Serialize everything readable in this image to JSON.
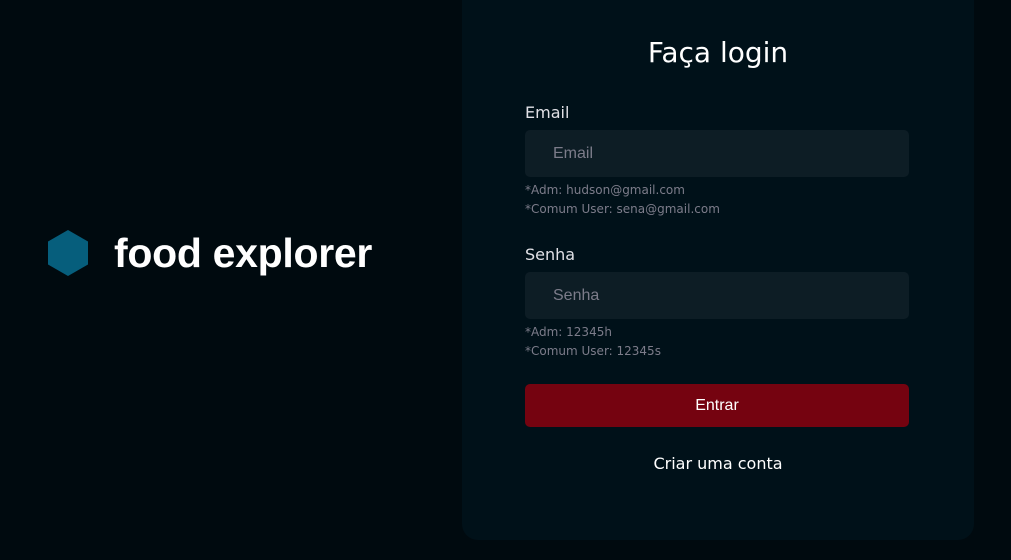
{
  "brand": {
    "name": "food explorer",
    "icon": "hexagon-logo-icon",
    "logo_color": "#065e7c"
  },
  "login": {
    "title": "Faça login",
    "email": {
      "label": "Email",
      "placeholder": "Email",
      "value": "",
      "hints": [
        "*Adm: hudson@gmail.com",
        "*Comum User: sena@gmail.com"
      ]
    },
    "password": {
      "label": "Senha",
      "placeholder": "Senha",
      "value": "",
      "hints": [
        "*Adm: 12345h",
        "*Comum User: 12345s"
      ]
    },
    "submit_label": "Entrar",
    "create_account_label": "Criar uma conta"
  },
  "colors": {
    "background": "#000a0f",
    "card": "#001119",
    "input_bg": "#0d1d25",
    "button": "#750310",
    "hint_text": "#7c7c8a"
  }
}
